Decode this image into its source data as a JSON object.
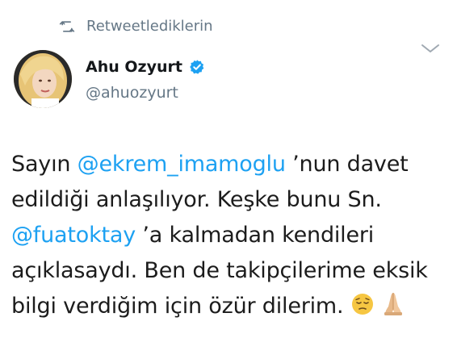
{
  "retweet": {
    "icon": "retweet-icon",
    "label": "Retweetlediklerin"
  },
  "author": {
    "name": "Ahu Ozyurt",
    "handle": "@ahuozyurt",
    "verified_icon": "verified-badge-icon",
    "avatar_icon": "profile-avatar"
  },
  "menu_icon": "chevron-down-icon",
  "tweet": {
    "line1_pre": "Sayın ",
    "mention1": "@ekrem_imamoglu",
    "line1_post": " ’nun davet",
    "line2": "edildiği anlaşılıyor. Keşke bunu Sn.",
    "mention2": "@fuatoktay",
    "line3_post": " ’a kalmadan kendileri",
    "line4": "açıklasaydı. Ben de takipçilerime eksik",
    "line5": "bilgi verdiğim için özür dilerim.",
    "emoji1": "pensive-face-emoji",
    "emoji2": "folded-hands-emoji"
  },
  "colors": {
    "mention": "#1da1f2",
    "muted": "#657786",
    "verified": "#1da1f2"
  }
}
